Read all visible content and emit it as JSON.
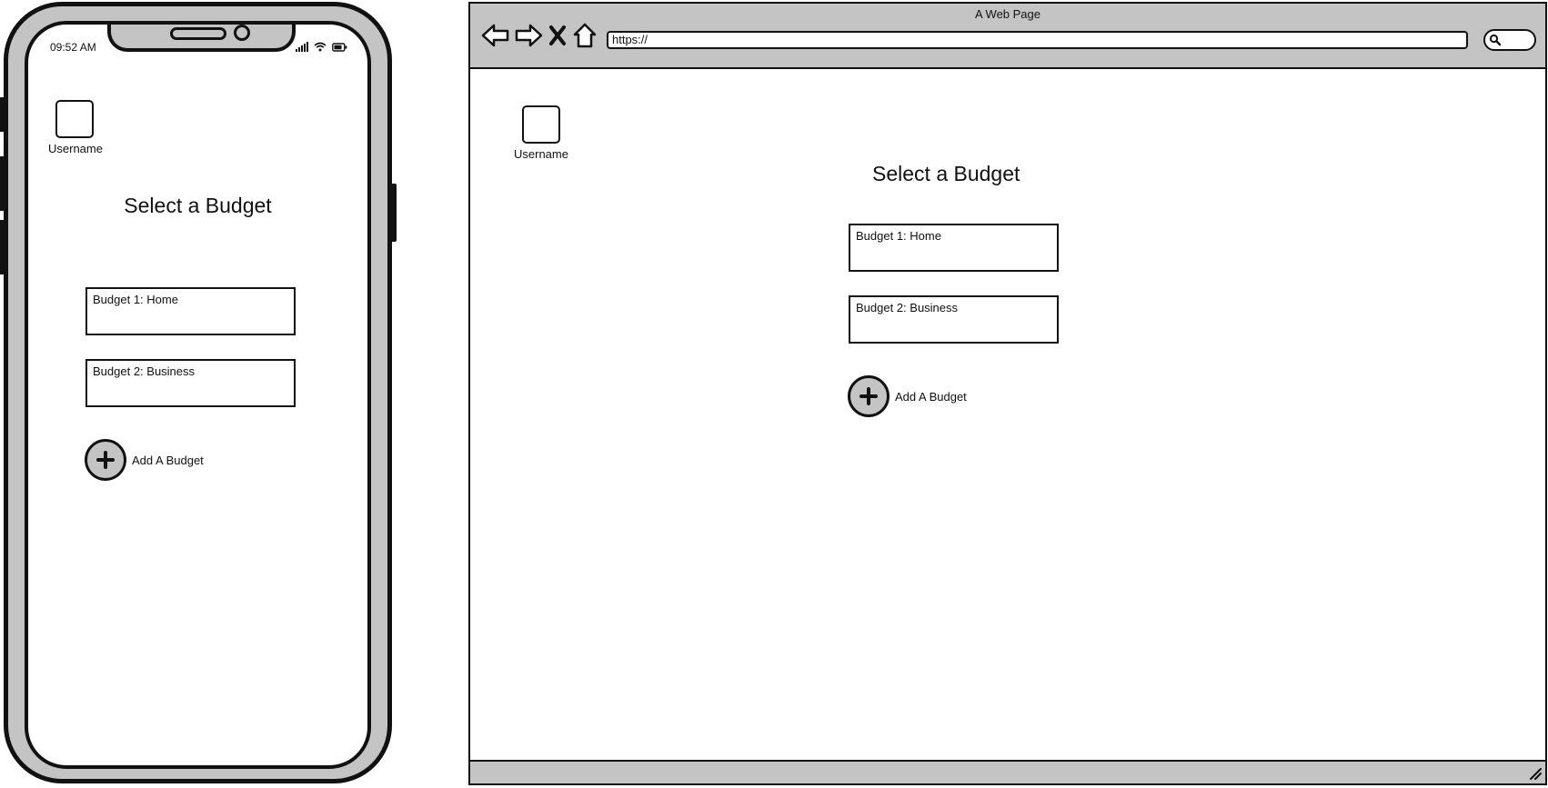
{
  "phone": {
    "status_time": "09:52 AM",
    "username": "Username",
    "title": "Select a Budget",
    "budgets": [
      {
        "label": "Budget 1: Home"
      },
      {
        "label": "Budget 2: Business"
      }
    ],
    "add_budget_label": "Add A Budget"
  },
  "browser": {
    "window_title": "A Web Page",
    "url": "https://",
    "username": "Username",
    "title": "Select a Budget",
    "budgets": [
      {
        "label": "Budget 1: Home"
      },
      {
        "label": "Budget 2: Business"
      }
    ],
    "add_budget_label": "Add A Budget"
  },
  "icons": {
    "back": "back-arrow-icon",
    "forward": "forward-arrow-icon",
    "stop": "close-icon",
    "home": "home-icon",
    "search": "search-icon",
    "add": "plus-icon",
    "signal": "signal-icon",
    "wifi": "wifi-icon",
    "battery": "battery-icon"
  },
  "colors": {
    "frame_gray": "#c4c4c4",
    "stroke": "#111111",
    "background": "#ffffff"
  }
}
